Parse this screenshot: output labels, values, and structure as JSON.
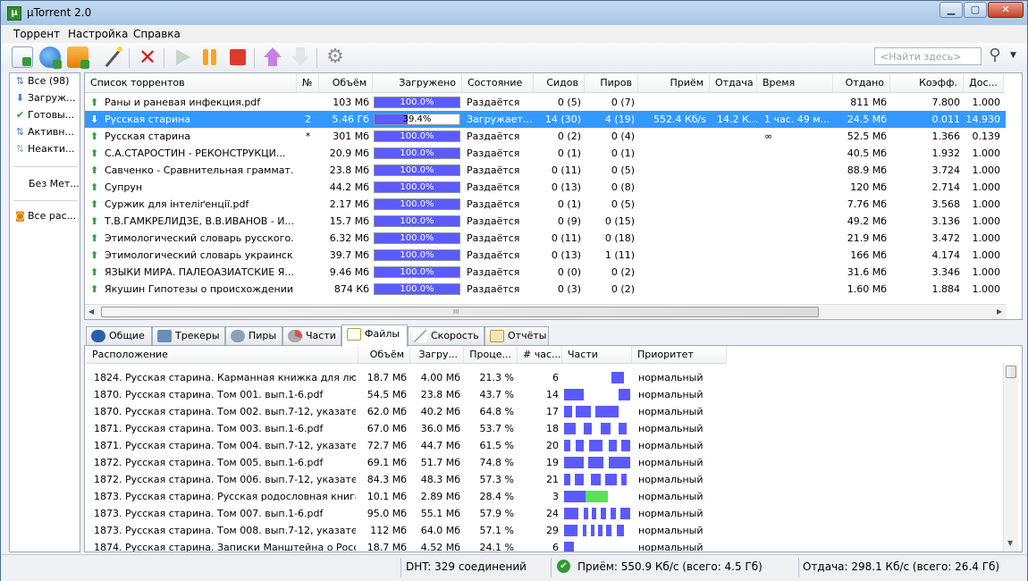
{
  "window": {
    "title": "µTorrent 2.0",
    "app_icon_label": "µ",
    "btn_min": "▁",
    "btn_max": "▢",
    "btn_close": "✕"
  },
  "menu": [
    "Торрент",
    "Настройка",
    "Справка"
  ],
  "toolbar": {
    "search_placeholder": "<Найти здесь>",
    "icons": [
      "add-torrent-icon",
      "add-url-icon",
      "add-rss-icon",
      "create-torrent-icon",
      "remove-icon",
      "start-icon",
      "pause-icon",
      "stop-icon",
      "move-up-icon",
      "move-down-icon",
      "settings-icon"
    ]
  },
  "sidebar": {
    "items": [
      "Все (98)",
      "Загруж...",
      "Готовы...",
      "Активн...",
      "Неакти..."
    ],
    "labels": "Без Мет...",
    "rss": "Все рас..."
  },
  "torrents": {
    "headers": [
      "Список торрентов",
      "№",
      "Объём",
      "Загружено",
      "Состояние",
      "Сидов",
      "Пиров",
      "Приём",
      "Отдача",
      "Время",
      "Отдано",
      "Коэфф.",
      "Дос..."
    ],
    "rows": [
      {
        "name": "Раны и раневая инфекция.pdf",
        "num": "",
        "size": "103 Мб",
        "done": "100.0%",
        "pct": 1,
        "status": "Раздаётся",
        "seeds": "0 (5)",
        "peers": "0 (7)",
        "down": "",
        "up": "",
        "eta": "",
        "uploaded": "811 Мб",
        "ratio": "7.800",
        "avail": "1.000",
        "state": "up"
      },
      {
        "name": "Русская старина",
        "num": "2",
        "size": "5.46 Гб",
        "done": "39.4%",
        "pct": 0.394,
        "status": "Загружает...",
        "seeds": "14 (30)",
        "peers": "4 (19)",
        "down": "552.4 Кб/s",
        "up": "14.2 К...",
        "eta": "1 час. 49 м...",
        "uploaded": "24.5 Мб",
        "ratio": "0.011",
        "avail": "14.930",
        "state": "down"
      },
      {
        "name": "Русская старина",
        "num": "*",
        "size": "301 Мб",
        "done": "100.0%",
        "pct": 1,
        "status": "Раздаётся",
        "seeds": "0 (2)",
        "peers": "0 (4)",
        "down": "",
        "up": "",
        "eta": "∞",
        "uploaded": "52.5 Мб",
        "ratio": "1.366",
        "avail": "0.139",
        "state": "up"
      },
      {
        "name": "С.А.СТАРОСТИН - РЕКОНСТРУКЦИ...",
        "num": "",
        "size": "20.9 Мб",
        "done": "100.0%",
        "pct": 1,
        "status": "Раздаётся",
        "seeds": "0 (1)",
        "peers": "0 (1)",
        "down": "",
        "up": "",
        "eta": "",
        "uploaded": "40.5 Мб",
        "ratio": "1.932",
        "avail": "1.000",
        "state": "up"
      },
      {
        "name": "Савченко - Сравнительная граммат...",
        "num": "",
        "size": "23.8 Мб",
        "done": "100.0%",
        "pct": 1,
        "status": "Раздаётся",
        "seeds": "0 (11)",
        "peers": "0 (5)",
        "down": "",
        "up": "",
        "eta": "",
        "uploaded": "88.9 Мб",
        "ratio": "3.724",
        "avail": "1.000",
        "state": "up"
      },
      {
        "name": "Супрун",
        "num": "",
        "size": "44.2 Мб",
        "done": "100.0%",
        "pct": 1,
        "status": "Раздаётся",
        "seeds": "0 (13)",
        "peers": "0 (8)",
        "down": "",
        "up": "",
        "eta": "",
        "uploaded": "120 Мб",
        "ratio": "2.714",
        "avail": "1.000",
        "state": "up"
      },
      {
        "name": "Суржик для інтеліґенції.pdf",
        "num": "",
        "size": "2.17 Мб",
        "done": "100.0%",
        "pct": 1,
        "status": "Раздаётся",
        "seeds": "0 (1)",
        "peers": "0 (5)",
        "down": "",
        "up": "",
        "eta": "",
        "uploaded": "7.76 Мб",
        "ratio": "3.568",
        "avail": "1.000",
        "state": "up"
      },
      {
        "name": "Т.В.ГАМКРЕЛИДЗЕ, В.В.ИВАНОВ - И...",
        "num": "",
        "size": "15.7 Мб",
        "done": "100.0%",
        "pct": 1,
        "status": "Раздаётся",
        "seeds": "0 (9)",
        "peers": "0 (15)",
        "down": "",
        "up": "",
        "eta": "",
        "uploaded": "49.2 Мб",
        "ratio": "3.136",
        "avail": "1.000",
        "state": "up"
      },
      {
        "name": "Этимологический словарь русского...",
        "num": "",
        "size": "6.32 Мб",
        "done": "100.0%",
        "pct": 1,
        "status": "Раздаётся",
        "seeds": "0 (11)",
        "peers": "0 (18)",
        "down": "",
        "up": "",
        "eta": "",
        "uploaded": "21.9 Мб",
        "ratio": "3.472",
        "avail": "1.000",
        "state": "up"
      },
      {
        "name": "Этимологический словарь украинск...",
        "num": "",
        "size": "39.7 Мб",
        "done": "100.0%",
        "pct": 1,
        "status": "Раздаётся",
        "seeds": "0 (13)",
        "peers": "1 (11)",
        "down": "",
        "up": "",
        "eta": "",
        "uploaded": "166 Мб",
        "ratio": "4.174",
        "avail": "1.000",
        "state": "up"
      },
      {
        "name": "ЯЗЫКИ МИРА. ПАЛЕОАЗИАТСКИЕ Я...",
        "num": "",
        "size": "9.46 Мб",
        "done": "100.0%",
        "pct": 1,
        "status": "Раздаётся",
        "seeds": "0 (0)",
        "peers": "0 (2)",
        "down": "",
        "up": "",
        "eta": "",
        "uploaded": "31.6 Мб",
        "ratio": "3.346",
        "avail": "1.000",
        "state": "up"
      },
      {
        "name": "Якушин Гипотезы о происхождении...",
        "num": "",
        "size": "874 Кб",
        "done": "100.0%",
        "pct": 1,
        "status": "Раздаётся",
        "seeds": "0 (3)",
        "peers": "0 (2)",
        "down": "",
        "up": "",
        "eta": "",
        "uploaded": "1.60 Мб",
        "ratio": "1.884",
        "avail": "1.000",
        "state": "up"
      }
    ]
  },
  "tabs": [
    "Общие",
    "Трекеры",
    "Пиры",
    "Части",
    "Файлы",
    "Скорость",
    "Отчёты"
  ],
  "files": {
    "headers": [
      "Расположение",
      "Объём",
      "Загру...",
      "Проце...",
      "# час...",
      "Части",
      "Приоритет"
    ],
    "rows": [
      {
        "path": "1824. Русская старина. Карманная книжка для люб...",
        "size": "18.7 Мб",
        "done": "4.00 Мб",
        "pct": "21.3 %",
        "pieces": "6",
        "prio": "нормальный",
        "map": [
          [
            0.72,
            0.9
          ]
        ]
      },
      {
        "path": "1870. Русская старина. Том 001. вып.1-6.pdf",
        "size": "54.5 Мб",
        "done": "23.8 Мб",
        "pct": "43.7 %",
        "pieces": "14",
        "prio": "нормальный",
        "map": [
          [
            0,
            0.3
          ],
          [
            0.82,
            1
          ]
        ]
      },
      {
        "path": "1870. Русская старина. Том 002. вып.7-12, указател...",
        "size": "62.0 Мб",
        "done": "40.2 Мб",
        "pct": "64.8 %",
        "pieces": "17",
        "prio": "нормальный",
        "map": [
          [
            0,
            0.12
          ],
          [
            0.18,
            0.4
          ],
          [
            0.47,
            0.82
          ]
        ]
      },
      {
        "path": "1871. Русская старина. Том 003. вып.1-6.pdf",
        "size": "67.0 Мб",
        "done": "36.0 Мб",
        "pct": "53.7 %",
        "pieces": "18",
        "prio": "нормальный",
        "map": [
          [
            0,
            0.17
          ],
          [
            0.3,
            0.42
          ],
          [
            0.55,
            0.7
          ],
          [
            0.82,
            0.95
          ]
        ]
      },
      {
        "path": "1871. Русская старина. Том 004. вып.7-12, указатель...",
        "size": "72.7 Мб",
        "done": "44.7 Мб",
        "pct": "61.5 %",
        "pieces": "20",
        "prio": "нормальный",
        "map": [
          [
            0,
            0.1
          ],
          [
            0.18,
            0.3
          ],
          [
            0.38,
            0.58
          ],
          [
            0.68,
            0.8
          ],
          [
            0.86,
            1
          ]
        ]
      },
      {
        "path": "1872. Русская старина. Том 005. вып.1-6.pdf",
        "size": "69.1 Мб",
        "done": "51.7 Мб",
        "pct": "74.8 %",
        "pieces": "19",
        "prio": "нормальный",
        "map": [
          [
            0,
            0.3
          ],
          [
            0.36,
            0.6
          ],
          [
            0.68,
            1
          ]
        ]
      },
      {
        "path": "1872. Русская старина. Том 006. вып.7-12, указател...",
        "size": "84.3 Мб",
        "done": "48.3 Мб",
        "pct": "57.3 %",
        "pieces": "21",
        "prio": "нормальный",
        "map": [
          [
            0,
            0.1
          ],
          [
            0.16,
            0.3
          ],
          [
            0.4,
            0.55
          ],
          [
            0.62,
            0.8
          ],
          [
            0.86,
            0.95
          ]
        ]
      },
      {
        "path": "1873. Русская старина. Русская родословная книга...",
        "size": "10.1 Мб",
        "done": "2.89 Мб",
        "pct": "28.4 %",
        "pieces": "3",
        "prio": "нормальный",
        "map": [
          [
            0,
            0.33
          ]
        ],
        "green": [
          0.33,
          0.66
        ]
      },
      {
        "path": "1873. Русская старина. Том 007. вып.1-6.pdf",
        "size": "95.0 Мб",
        "done": "55.1 Мб",
        "pct": "57.9 %",
        "pieces": "24",
        "prio": "нормальный",
        "map": [
          [
            0,
            0.22
          ],
          [
            0.3,
            0.36
          ],
          [
            0.42,
            0.48
          ],
          [
            0.55,
            0.63
          ],
          [
            0.7,
            0.78
          ],
          [
            0.85,
            1
          ]
        ]
      },
      {
        "path": "1873. Русская старина. Том 008. вып.7-12, указател...",
        "size": "112 Мб",
        "done": "64.0 Мб",
        "pct": "57.1 %",
        "pieces": "29",
        "prio": "нормальный",
        "map": [
          [
            0,
            0.2
          ],
          [
            0.28,
            0.34
          ],
          [
            0.4,
            0.46
          ],
          [
            0.52,
            0.58
          ],
          [
            0.64,
            0.72
          ],
          [
            0.8,
            0.9
          ]
        ]
      },
      {
        "path": "1874. Русская старина. Записки Манштейна о Росс...",
        "size": "18.7 Мб",
        "done": "4.52 Мб",
        "pct": "24.1 %",
        "pieces": "6",
        "prio": "нормальный",
        "map": [
          [
            0,
            0.15
          ]
        ]
      }
    ]
  },
  "status": {
    "dht": "DHT: 329 соединений",
    "down": "Приём: 550.9 Кб/с (всего: 4.5 Гб)",
    "up": "Отдача: 298.1 Кб/с (всего: 26.4 Гб)"
  }
}
